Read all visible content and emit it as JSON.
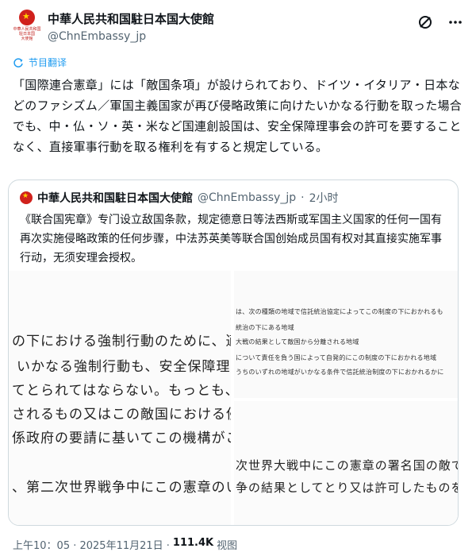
{
  "header": {
    "avatar_caption": "中華人民共和国\n駐日本国\n大使館",
    "display_name": "中華人民共和国駐日本国大使館",
    "handle": "@ChnEmbassy_jp",
    "icons": [
      "grok-icon",
      "more-icon"
    ]
  },
  "translate_label": "节目翻译",
  "main_text": "「国際連合憲章」には「敵国条項」が設けられており、ドイツ・イタリア・日本などのファシズム／軍国主義国家が再び侵略政策に向けたいかなる行動を取った場合でも、中・仏・ソ・英・米など国連創設国は、安全保障理事会の許可を要することなく、直接軍事行動を取る権利を有すると規定している。",
  "quote": {
    "display_name": "中華人民共和国駐日本国大使館",
    "handle": "@ChnEmbassy_jp",
    "time": "2小时",
    "text": "《联合国宪章》专门设立敌国条款，规定德意日等法西斯或军国主义国家的任何一国有再次实施侵略政策的任何步骤，中法苏英美等联合国创始成员国有权对其直接实施军事行动，无须安理会授权。",
    "image_left_lines": [
      "の下における強制行動のために、適当な",
      "いかなる強制行動も、安全保障理事会",
      "てとられてはならない。もっとも、本条",
      "されるもの又はこの敵国における侵略",
      "係政府の要請に基いてこの機構がこの敵",
      "、第二次世界戦争中にこの憲章のいず"
    ],
    "image_right_top_lines": [
      "は、次の種類の地域で信託統治協定によってこの制度の下におかれるも",
      "統治の下にある地域",
      "大戦の結果として敵国から分離される地域",
      "について責任を負う国によって自発的にこの制度の下におかれる地域",
      "うちのいずれの地域がいかなる条件で信託統治制度の下におかれるかに"
    ],
    "image_right_bottom_lines": [
      "次世界大戦中にこの憲章の署名国の敵であ",
      "争の結果としてとり又は許可したものを無"
    ]
  },
  "footer": {
    "timestamp": "上午10：05 · 2025年11月21日 ·",
    "views_count": "111.4K",
    "views_label": "视图"
  }
}
